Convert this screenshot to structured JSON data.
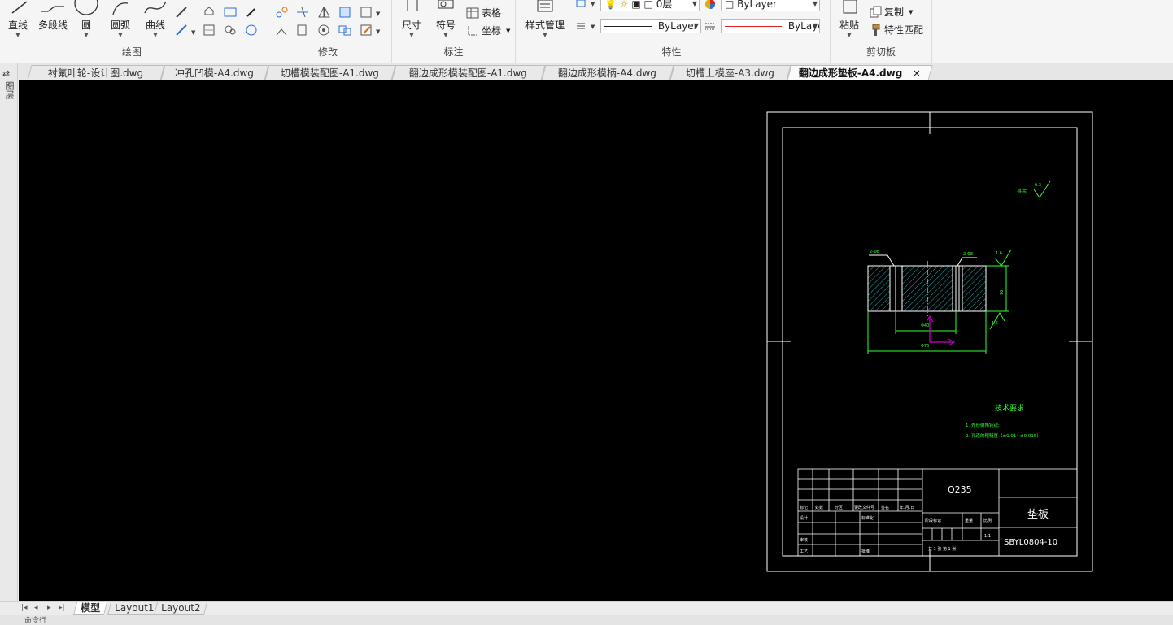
{
  "ribbon": {
    "draw": {
      "title": "绘图",
      "line": "直线",
      "polyline": "多段线",
      "circle": "圆",
      "arc": "圆弧",
      "curve": "曲线"
    },
    "modify": {
      "title": "修改"
    },
    "annotate": {
      "title": "标注",
      "dimension": "尺寸",
      "symbol": "符号",
      "table": "表格",
      "coordinate": "坐标"
    },
    "properties": {
      "title": "特性",
      "style_manager": "样式管理",
      "layer_value": "0层",
      "color_value": "ByLayer",
      "linetype_value": "ByLayer",
      "lineweight_value": "ByLayer"
    },
    "clipboard": {
      "title": "剪切板",
      "paste": "粘贴",
      "copy": "复制",
      "match_properties": "特性匹配"
    }
  },
  "tabs": [
    {
      "label": "衬氟叶轮-设计图.dwg"
    },
    {
      "label": "冲孔凹模-A4.dwg"
    },
    {
      "label": "切槽模装配图-A1.dwg"
    },
    {
      "label": "翻边成形模装配图-A1.dwg"
    },
    {
      "label": "翻边成形模柄-A4.dwg"
    },
    {
      "label": "切槽上模座-A3.dwg"
    },
    {
      "label": "翻边成形垫板-A4.dwg",
      "active": true
    }
  ],
  "close_tab_glyph": "×",
  "sidebar": {
    "label": "图层"
  },
  "layout_tabs": [
    {
      "label": "模型",
      "active": true
    },
    {
      "label": "Layout1"
    },
    {
      "label": "Layout2"
    }
  ],
  "nav_glyphs": {
    "first": "|◂",
    "prev": "◂",
    "next": "▸",
    "last": "▸|"
  },
  "command_line": {
    "prompt": "命令行"
  },
  "drawing": {
    "roughness_note": "其余",
    "roughness_value": "6.3",
    "leader_left": "2-Φ8",
    "leader_right": "2-Φ8",
    "roughness_right_top": "1.6",
    "roughness_right_bottom": "1.6",
    "dim_height": "16",
    "dim_inner": "Φ40",
    "dim_outer": "Φ75",
    "tech_title": "技术要求",
    "tech_line1": "1. 外形倒角钝锐;",
    "tech_line2": "2. 孔道的粗糙度（±0.01~±0.015）",
    "material": "Q235",
    "part_name": "垫板",
    "drawing_number": "SBYL0804-10",
    "scale": "1:1",
    "tb_mark": "标记",
    "tb_count": "处数",
    "tb_zone": "分区",
    "tb_docno": "更改文件号",
    "tb_sign": "签名",
    "tb_date": "年.月.日",
    "tb_design": "设计",
    "tb_standard": "标准化",
    "tb_stage": "阶段标记",
    "tb_weight": "重量",
    "tb_ratio": "比例",
    "tb_review": "审核",
    "tb_process": "工艺",
    "tb_approve": "批准",
    "tb_sheets": "共 1 张  第 1 张"
  },
  "colors": {
    "canvas": "#000000",
    "drawing_white": "#ffffff",
    "drawing_green": "#33ff33",
    "drawing_cyan": "#22d8d8",
    "ucs_magenta": "#d000d0",
    "color_swatch_red": "#e02020"
  }
}
